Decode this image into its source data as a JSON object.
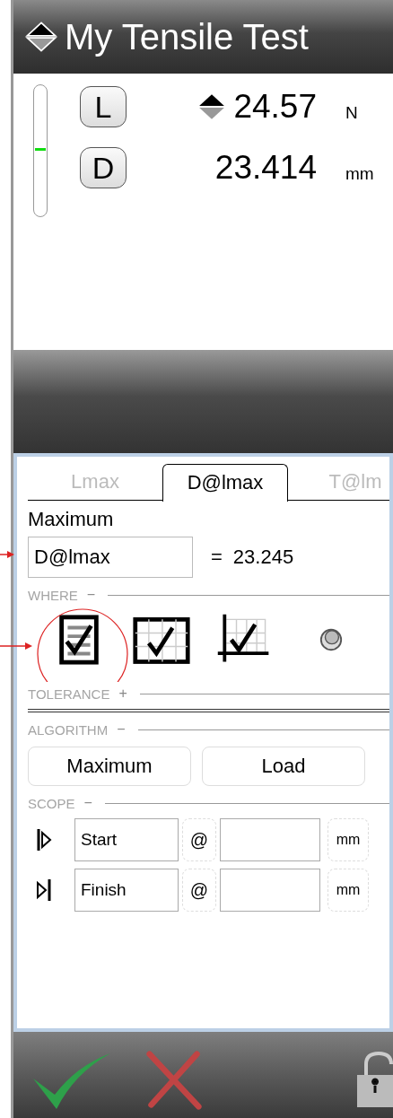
{
  "title": "My Tensile Test",
  "gauge": {
    "level": 0.5
  },
  "readings": [
    {
      "key": "L",
      "value": "24.57",
      "unit": "N",
      "sort_arrows": true
    },
    {
      "key": "D",
      "value": "23.414",
      "unit": "mm",
      "sort_arrows": false
    }
  ],
  "tabs": [
    {
      "label": "Lmax",
      "selected": false
    },
    {
      "label": "D@lmax",
      "selected": true
    },
    {
      "label": "T@lm",
      "selected": false
    }
  ],
  "result": {
    "heading": "Maximum",
    "name": "D@lmax",
    "equals": "=",
    "value": "23.245"
  },
  "where": {
    "label": "WHERE",
    "toggle": "−",
    "options": [
      {
        "kind": "report"
      },
      {
        "kind": "table"
      },
      {
        "kind": "graph"
      },
      {
        "kind": "marker"
      }
    ]
  },
  "tolerance": {
    "label": "TOLERANCE",
    "toggle": "+"
  },
  "algorithm": {
    "label": "ALGORITHM",
    "toggle": "−",
    "buttons": [
      "Maximum",
      "Load"
    ]
  },
  "scope": {
    "label": "SCOPE",
    "toggle": "−",
    "rows": [
      {
        "kind": "start",
        "label": "Start",
        "at": "@",
        "unit": "mm"
      },
      {
        "kind": "finish",
        "label": "Finish",
        "at": "@",
        "unit": "mm"
      }
    ]
  }
}
